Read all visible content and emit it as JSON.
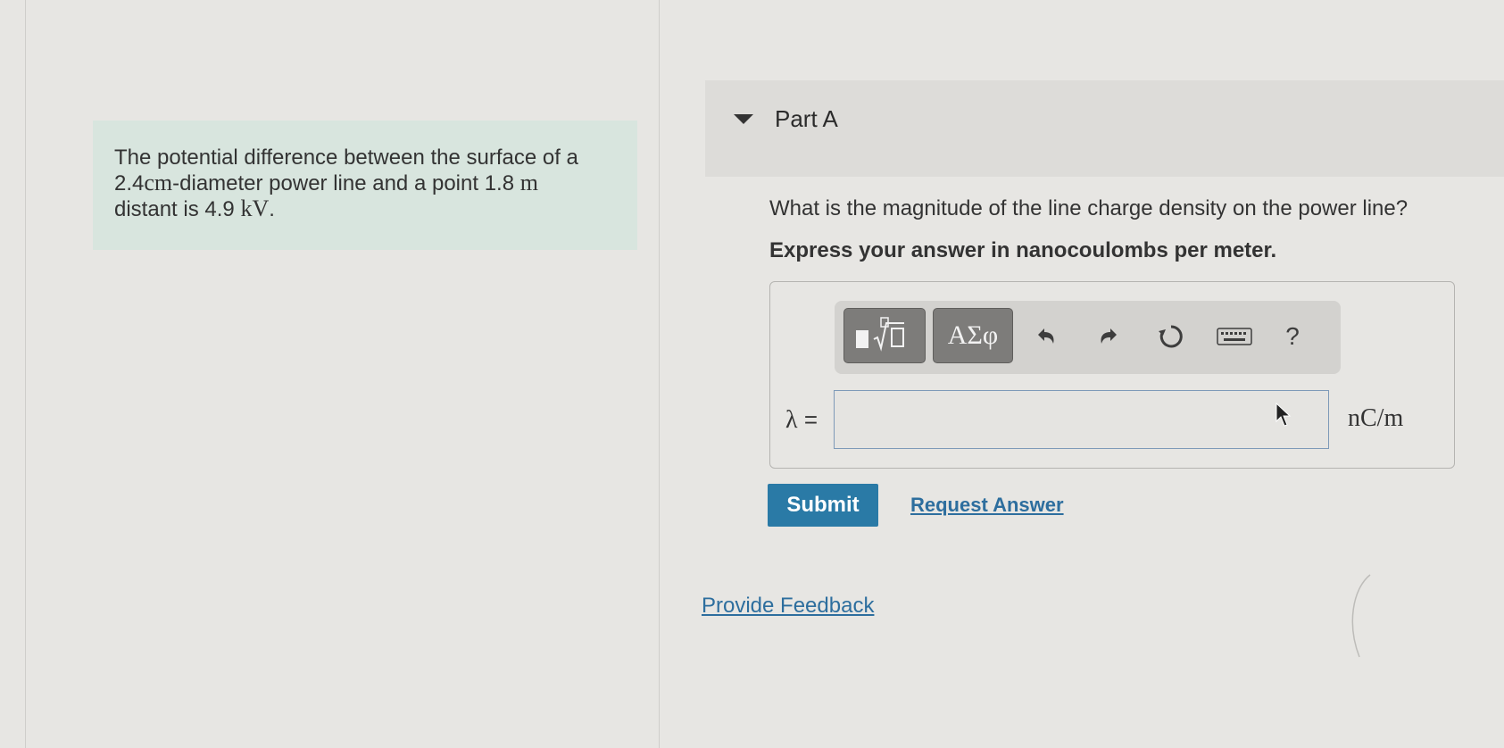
{
  "problem": {
    "text_1": "The potential difference between the surface of a",
    "value_diameter": "2.4",
    "unit_diameter": "cm",
    "text_2": "-diameter power line and a point ",
    "value_distance": "1.8",
    "unit_distance": "m",
    "text_3": "distant is ",
    "value_voltage": "4.9",
    "unit_voltage": "kV",
    "text_end": "."
  },
  "part": {
    "title": "Part A",
    "question": "What is the magnitude of the line charge density on the power line?",
    "instruction": "Express your answer in nanocoulombs per meter."
  },
  "toolbar": {
    "templates_icon": "templates-sqrt-icon",
    "symbols_label": "ΑΣφ",
    "undo_icon": "undo-icon",
    "redo_icon": "redo-icon",
    "reset_icon": "reset-icon",
    "keyboard_icon": "keyboard-icon",
    "help_label": "?"
  },
  "answer": {
    "variable": "λ",
    "equals": "=",
    "value": "",
    "units": "nC/m"
  },
  "actions": {
    "submit_label": "Submit",
    "request_answer_label": "Request Answer",
    "feedback_label": "Provide Feedback"
  },
  "colors": {
    "problem_bg": "#d8e5de",
    "submit_bg": "#2a7aa6",
    "link": "#2d6e9e",
    "toolbar_button": "#7d7c7a"
  }
}
